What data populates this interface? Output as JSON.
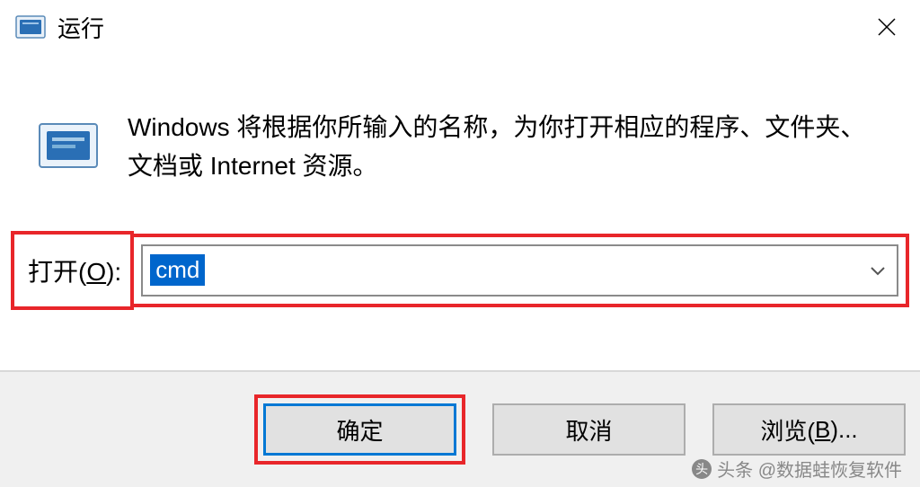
{
  "titlebar": {
    "title": "运行"
  },
  "content": {
    "description": "Windows 将根据你所输入的名称，为你打开相应的程序、文件夹、文档或 Internet 资源。"
  },
  "input": {
    "label_prefix": "打开(",
    "label_accel": "O",
    "label_suffix": "):",
    "value": "cmd"
  },
  "buttons": {
    "ok": "确定",
    "cancel": "取消",
    "browse_prefix": "浏览(",
    "browse_accel": "B",
    "browse_suffix": ")..."
  },
  "watermark": {
    "text": "头条 @数据蛙恢复软件"
  }
}
